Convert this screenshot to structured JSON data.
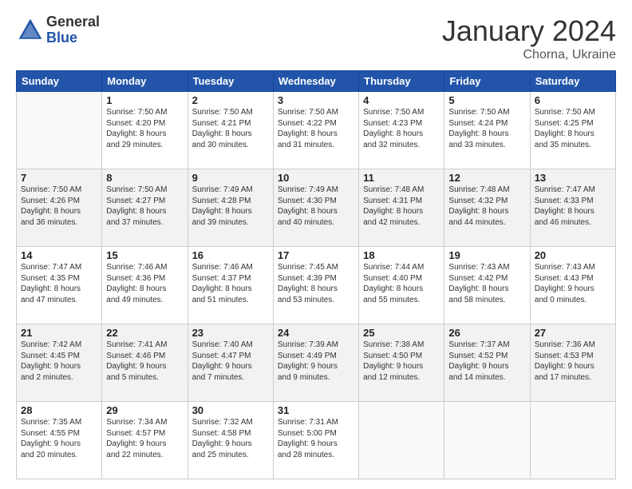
{
  "logo": {
    "general": "General",
    "blue": "Blue"
  },
  "title": "January 2024",
  "location": "Chorna, Ukraine",
  "days_of_week": [
    "Sunday",
    "Monday",
    "Tuesday",
    "Wednesday",
    "Thursday",
    "Friday",
    "Saturday"
  ],
  "weeks": [
    [
      {
        "day": "",
        "info": ""
      },
      {
        "day": "1",
        "info": "Sunrise: 7:50 AM\nSunset: 4:20 PM\nDaylight: 8 hours\nand 29 minutes."
      },
      {
        "day": "2",
        "info": "Sunrise: 7:50 AM\nSunset: 4:21 PM\nDaylight: 8 hours\nand 30 minutes."
      },
      {
        "day": "3",
        "info": "Sunrise: 7:50 AM\nSunset: 4:22 PM\nDaylight: 8 hours\nand 31 minutes."
      },
      {
        "day": "4",
        "info": "Sunrise: 7:50 AM\nSunset: 4:23 PM\nDaylight: 8 hours\nand 32 minutes."
      },
      {
        "day": "5",
        "info": "Sunrise: 7:50 AM\nSunset: 4:24 PM\nDaylight: 8 hours\nand 33 minutes."
      },
      {
        "day": "6",
        "info": "Sunrise: 7:50 AM\nSunset: 4:25 PM\nDaylight: 8 hours\nand 35 minutes."
      }
    ],
    [
      {
        "day": "7",
        "info": "Sunrise: 7:50 AM\nSunset: 4:26 PM\nDaylight: 8 hours\nand 36 minutes."
      },
      {
        "day": "8",
        "info": "Sunrise: 7:50 AM\nSunset: 4:27 PM\nDaylight: 8 hours\nand 37 minutes."
      },
      {
        "day": "9",
        "info": "Sunrise: 7:49 AM\nSunset: 4:28 PM\nDaylight: 8 hours\nand 39 minutes."
      },
      {
        "day": "10",
        "info": "Sunrise: 7:49 AM\nSunset: 4:30 PM\nDaylight: 8 hours\nand 40 minutes."
      },
      {
        "day": "11",
        "info": "Sunrise: 7:48 AM\nSunset: 4:31 PM\nDaylight: 8 hours\nand 42 minutes."
      },
      {
        "day": "12",
        "info": "Sunrise: 7:48 AM\nSunset: 4:32 PM\nDaylight: 8 hours\nand 44 minutes."
      },
      {
        "day": "13",
        "info": "Sunrise: 7:47 AM\nSunset: 4:33 PM\nDaylight: 8 hours\nand 46 minutes."
      }
    ],
    [
      {
        "day": "14",
        "info": "Sunrise: 7:47 AM\nSunset: 4:35 PM\nDaylight: 8 hours\nand 47 minutes."
      },
      {
        "day": "15",
        "info": "Sunrise: 7:46 AM\nSunset: 4:36 PM\nDaylight: 8 hours\nand 49 minutes."
      },
      {
        "day": "16",
        "info": "Sunrise: 7:46 AM\nSunset: 4:37 PM\nDaylight: 8 hours\nand 51 minutes."
      },
      {
        "day": "17",
        "info": "Sunrise: 7:45 AM\nSunset: 4:39 PM\nDaylight: 8 hours\nand 53 minutes."
      },
      {
        "day": "18",
        "info": "Sunrise: 7:44 AM\nSunset: 4:40 PM\nDaylight: 8 hours\nand 55 minutes."
      },
      {
        "day": "19",
        "info": "Sunrise: 7:43 AM\nSunset: 4:42 PM\nDaylight: 8 hours\nand 58 minutes."
      },
      {
        "day": "20",
        "info": "Sunrise: 7:43 AM\nSunset: 4:43 PM\nDaylight: 9 hours\nand 0 minutes."
      }
    ],
    [
      {
        "day": "21",
        "info": "Sunrise: 7:42 AM\nSunset: 4:45 PM\nDaylight: 9 hours\nand 2 minutes."
      },
      {
        "day": "22",
        "info": "Sunrise: 7:41 AM\nSunset: 4:46 PM\nDaylight: 9 hours\nand 5 minutes."
      },
      {
        "day": "23",
        "info": "Sunrise: 7:40 AM\nSunset: 4:47 PM\nDaylight: 9 hours\nand 7 minutes."
      },
      {
        "day": "24",
        "info": "Sunrise: 7:39 AM\nSunset: 4:49 PM\nDaylight: 9 hours\nand 9 minutes."
      },
      {
        "day": "25",
        "info": "Sunrise: 7:38 AM\nSunset: 4:50 PM\nDaylight: 9 hours\nand 12 minutes."
      },
      {
        "day": "26",
        "info": "Sunrise: 7:37 AM\nSunset: 4:52 PM\nDaylight: 9 hours\nand 14 minutes."
      },
      {
        "day": "27",
        "info": "Sunrise: 7:36 AM\nSunset: 4:53 PM\nDaylight: 9 hours\nand 17 minutes."
      }
    ],
    [
      {
        "day": "28",
        "info": "Sunrise: 7:35 AM\nSunset: 4:55 PM\nDaylight: 9 hours\nand 20 minutes."
      },
      {
        "day": "29",
        "info": "Sunrise: 7:34 AM\nSunset: 4:57 PM\nDaylight: 9 hours\nand 22 minutes."
      },
      {
        "day": "30",
        "info": "Sunrise: 7:32 AM\nSunset: 4:58 PM\nDaylight: 9 hours\nand 25 minutes."
      },
      {
        "day": "31",
        "info": "Sunrise: 7:31 AM\nSunset: 5:00 PM\nDaylight: 9 hours\nand 28 minutes."
      },
      {
        "day": "",
        "info": ""
      },
      {
        "day": "",
        "info": ""
      },
      {
        "day": "",
        "info": ""
      }
    ]
  ]
}
